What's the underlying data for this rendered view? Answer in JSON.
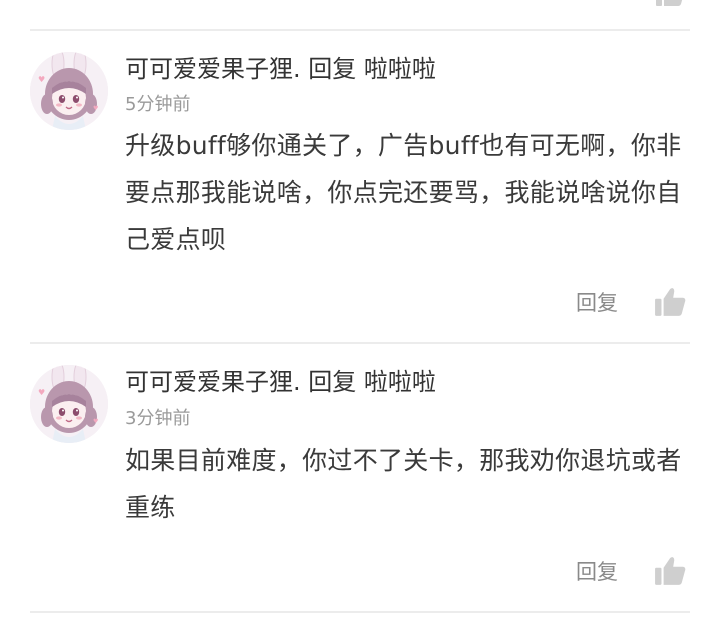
{
  "comments": [
    {
      "author": "可可爱爱果子狸.",
      "reply_word": "回复",
      "reply_to": "啦啦啦",
      "time": "5分钟前",
      "text": "升级buff够你通关了，广告buff也有可无啊，你非要点那我能说啥，你点完还要骂，我能说啥说你自己爱点呗",
      "reply_label": "回复",
      "like_icon": "thumbs-up-icon"
    },
    {
      "author": "可可爱爱果子狸.",
      "reply_word": "回复",
      "reply_to": "啦啦啦",
      "time": "3分钟前",
      "text": "如果目前难度，你过不了关卡，那我劝你退坑或者重练",
      "reply_label": "回复",
      "like_icon": "thumbs-up-icon"
    }
  ],
  "colors": {
    "text_primary": "#333333",
    "text_secondary": "#9a9a9a",
    "action_gray": "#8a8a8a",
    "icon_gray": "#cfcfcf",
    "divider": "#ececec"
  }
}
